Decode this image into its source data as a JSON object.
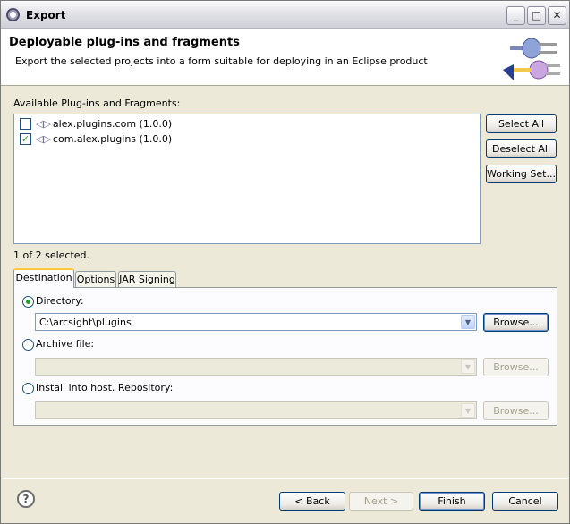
{
  "window": {
    "title": "Export"
  },
  "header": {
    "title": "Deployable plug-ins and fragments",
    "description": "Export the selected projects into a form suitable for deploying in an Eclipse product"
  },
  "plugins": {
    "label": "Available Plug-ins and Fragments:",
    "items": [
      {
        "name": "alex.plugins.com (1.0.0)",
        "checked": false
      },
      {
        "name": "com.alex.plugins (1.0.0)",
        "checked": true
      }
    ],
    "selection_status": "1 of 2 selected."
  },
  "side_buttons": {
    "select_all": "Select All",
    "deselect_all": "Deselect All",
    "working_set": "Working Set..."
  },
  "tabs": [
    {
      "label": "Destination",
      "active": true
    },
    {
      "label": "Options",
      "active": false
    },
    {
      "label": "JAR Signing",
      "active": false
    }
  ],
  "destination": {
    "directory_label": "Directory:",
    "directory_value": "C:\\arcsight\\plugins",
    "archive_label": "Archive file:",
    "archive_value": "",
    "install_label": "Install into host. Repository:",
    "install_value": "",
    "browse_label": "Browse..."
  },
  "footer": {
    "help_icon": "?",
    "back_label": "< Back",
    "next_label": "Next >",
    "finish_label": "Finish",
    "cancel_label": "Cancel"
  }
}
